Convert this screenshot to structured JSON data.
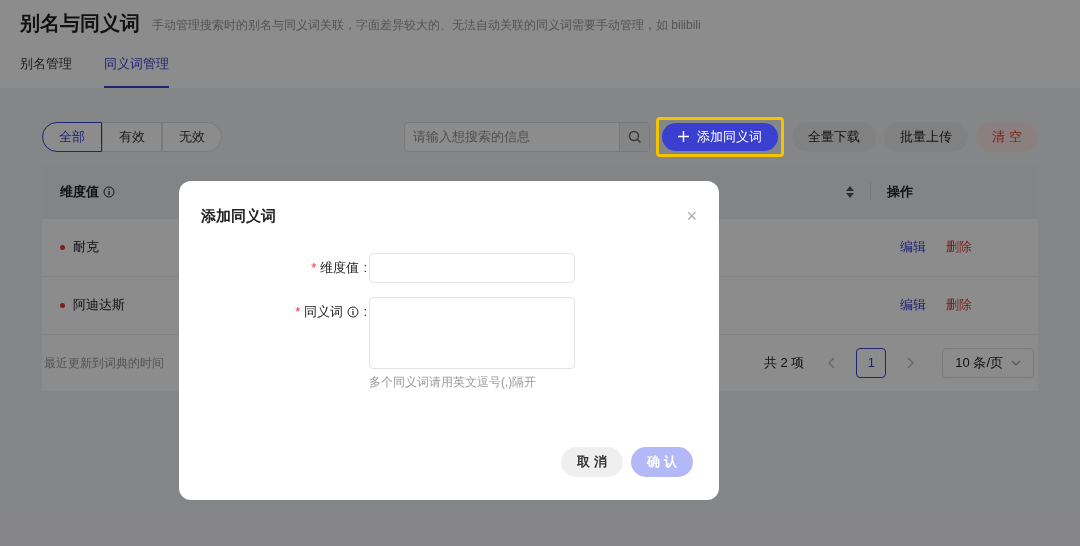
{
  "page": {
    "title": "别名与同义词",
    "description": "手动管理搜索时的别名与同义词关联，字面差异较大的、无法自动关联的同义词需要手动管理，如 bilibili"
  },
  "tabs": [
    {
      "label": "别名管理",
      "selected": false
    },
    {
      "label": "同义词管理",
      "selected": true
    }
  ],
  "filters": [
    {
      "label": "全部",
      "selected": true
    },
    {
      "label": "有效",
      "selected": false
    },
    {
      "label": "无效",
      "selected": false
    }
  ],
  "search": {
    "placeholder": "请输入想搜索的信息"
  },
  "add_button": {
    "label": "添加同义词",
    "highlighted": true
  },
  "buttons": [
    {
      "label": "全量下载",
      "kind": "default"
    },
    {
      "label": "批量上传",
      "kind": "default"
    },
    {
      "label": "清 空",
      "kind": "danger"
    }
  ],
  "table": {
    "columns": [
      {
        "label": "维度值",
        "info": true
      },
      {
        "label": "操作",
        "info": false
      }
    ],
    "rows": [
      {
        "dimension": "耐克",
        "actions": [
          {
            "label": "编辑",
            "kind": "primary"
          },
          {
            "label": "删除",
            "kind": "danger"
          }
        ]
      },
      {
        "dimension": "阿迪达斯",
        "actions": [
          {
            "label": "编辑",
            "kind": "primary"
          },
          {
            "label": "删除",
            "kind": "danger"
          }
        ]
      }
    ]
  },
  "footer": {
    "update_label": "最近更新到词典的时间",
    "total": "共 2 项",
    "pages": [
      {
        "label": "1",
        "selected": true
      }
    ],
    "page_size": "10 条/页"
  },
  "dialog": {
    "title": "添加同义词",
    "close": "×",
    "fields": [
      {
        "required": true,
        "required_mark": "*",
        "label": "维度值",
        "info": false,
        "colon": ":",
        "kind": "input"
      },
      {
        "required": true,
        "required_mark": "*",
        "label": "同义词",
        "info": true,
        "colon": ":",
        "kind": "textarea",
        "hint": "多个同义词请用英文逗号(,)隔开"
      }
    ],
    "buttons": [
      {
        "label": "取 消",
        "kind": "cancel",
        "disabled": false
      },
      {
        "label": "确 认",
        "kind": "confirm",
        "disabled": true
      }
    ]
  }
}
